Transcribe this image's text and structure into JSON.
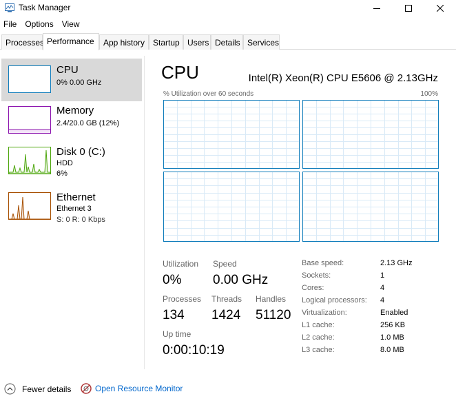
{
  "window": {
    "title": "Task Manager"
  },
  "menu": [
    "File",
    "Options",
    "View"
  ],
  "tabs": [
    "Processes",
    "Performance",
    "App history",
    "Startup",
    "Users",
    "Details",
    "Services"
  ],
  "active_tab": "Performance",
  "sidebar": {
    "items": [
      {
        "title": "CPU",
        "line1": "0% 0.00 GHz",
        "line2": "",
        "color": "#117dbb"
      },
      {
        "title": "Memory",
        "line1": "2.4/20.0 GB (12%)",
        "line2": "",
        "color": "#8b12ae"
      },
      {
        "title": "Disk 0 (C:)",
        "line1": "HDD",
        "line2": "6%",
        "color": "#4da60c"
      },
      {
        "title": "Ethernet",
        "line1": "Ethernet 3",
        "line2": "S: 0 R: 0 Kbps",
        "color": "#a74f01"
      }
    ]
  },
  "main": {
    "title": "CPU",
    "cpu_name": "Intel(R) Xeon(R) CPU E5606 @ 2.13GHz",
    "util_label": "% Utilization over 60 seconds",
    "util_max": "100%",
    "graph_color": "#117dbb",
    "stats": {
      "utilization_label": "Utilization",
      "utilization_value": "0%",
      "speed_label": "Speed",
      "speed_value": "0.00 GHz",
      "processes_label": "Processes",
      "processes_value": "134",
      "threads_label": "Threads",
      "threads_value": "1424",
      "handles_label": "Handles",
      "handles_value": "51120",
      "uptime_label": "Up time",
      "uptime_value": "0:00:10:19"
    },
    "specs": [
      {
        "label": "Base speed:",
        "value": "2.13 GHz"
      },
      {
        "label": "Sockets:",
        "value": "1"
      },
      {
        "label": "Cores:",
        "value": "4"
      },
      {
        "label": "Logical processors:",
        "value": "4"
      },
      {
        "label": "Virtualization:",
        "value": "Enabled"
      },
      {
        "label": "L1 cache:",
        "value": "256 KB"
      },
      {
        "label": "L2 cache:",
        "value": "1.0 MB"
      },
      {
        "label": "L3 cache:",
        "value": "8.0 MB"
      }
    ]
  },
  "footer": {
    "fewer_details": "Fewer details",
    "open_resource_monitor": "Open Resource Monitor"
  }
}
